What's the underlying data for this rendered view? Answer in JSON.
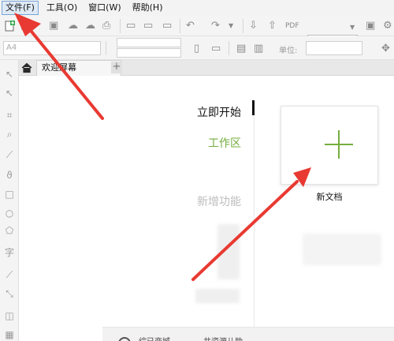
{
  "menu": {
    "items": [
      {
        "label": "文件(F)",
        "active": true
      },
      {
        "label": "工具(O)",
        "active": false
      },
      {
        "label": "窗口(W)",
        "active": false
      },
      {
        "label": "帮助(H)",
        "active": false
      }
    ]
  },
  "toolbar": {
    "page_size_value": "A4",
    "units_label": "单位:",
    "accent_color": "#1d72c9"
  },
  "tabs": {
    "welcome_label": "欢迎屏幕",
    "add_label": "+"
  },
  "welcome": {
    "nav_start": "立即开始",
    "nav_workspace": "工作区",
    "nav_new_features": "新增功能",
    "new_doc_label": "新文档",
    "accent_green": "#74ad3f"
  },
  "bottom": {
    "text_left": "综已商城",
    "text_right": "共资源儿助"
  },
  "annotation": {
    "arrow_color": "#e83a32"
  }
}
